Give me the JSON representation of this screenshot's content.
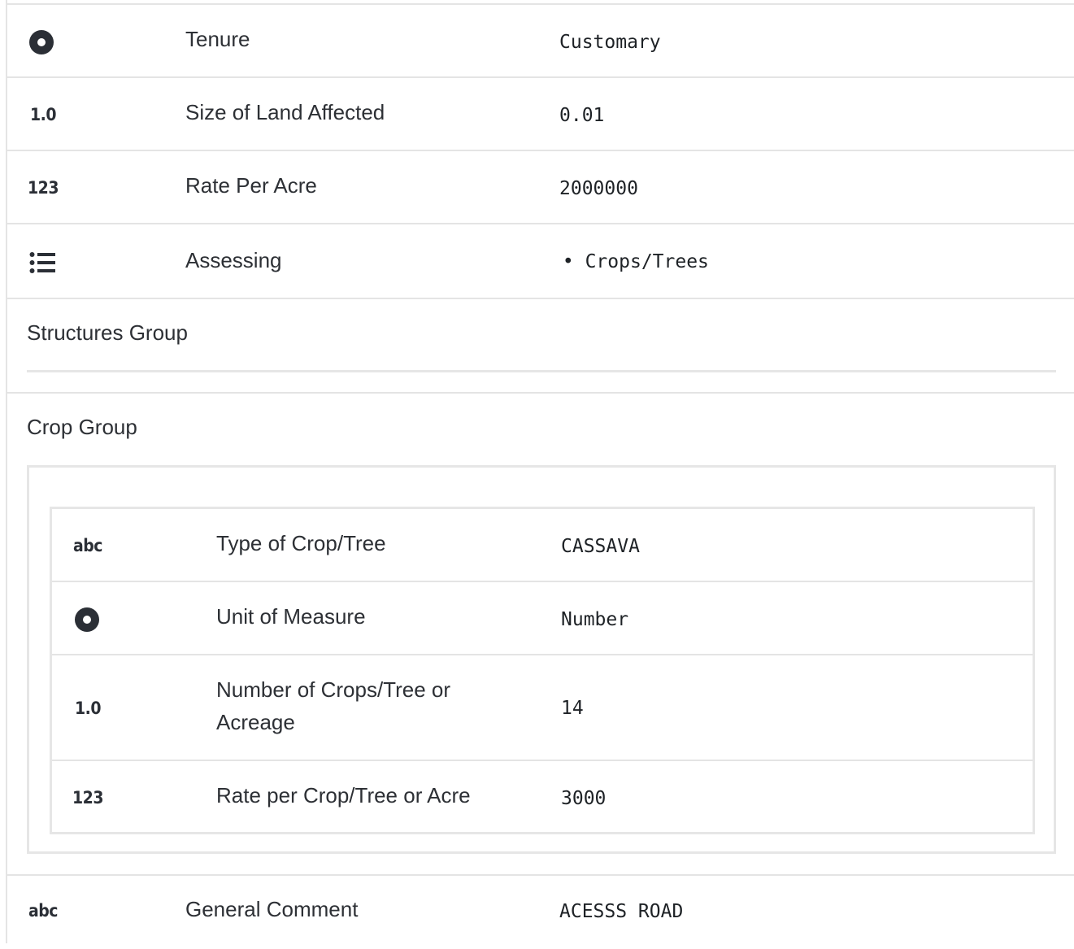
{
  "rows": {
    "tenure": {
      "icon": "radio-icon",
      "label": "Tenure",
      "value": "Customary"
    },
    "land_size": {
      "icon_text": "1.0",
      "label": "Size of Land Affected",
      "value": "0.01"
    },
    "rate_per_acre": {
      "icon_text": "123",
      "label": "Rate Per Acre",
      "value": "2000000"
    },
    "assessing": {
      "icon": "list-icon",
      "label": "Assessing",
      "values": [
        "Crops/Trees"
      ]
    }
  },
  "structures_group": {
    "title": "Structures Group"
  },
  "crop_group": {
    "title": "Crop Group",
    "rows": {
      "type": {
        "icon_text": "abc",
        "label": "Type of Crop/Tree",
        "value": "CASSAVA"
      },
      "unit": {
        "icon": "radio-icon",
        "label": "Unit of Measure",
        "value": "Number"
      },
      "count": {
        "icon_text": "1.0",
        "label": "Number of Crops/Tree or Acreage",
        "value": "14"
      },
      "rate": {
        "icon_text": "123",
        "label": "Rate per Crop/Tree or Acre",
        "value": "3000"
      }
    }
  },
  "general_comment": {
    "icon_text": "abc",
    "label": "General Comment",
    "value": "ACESSS ROAD"
  }
}
